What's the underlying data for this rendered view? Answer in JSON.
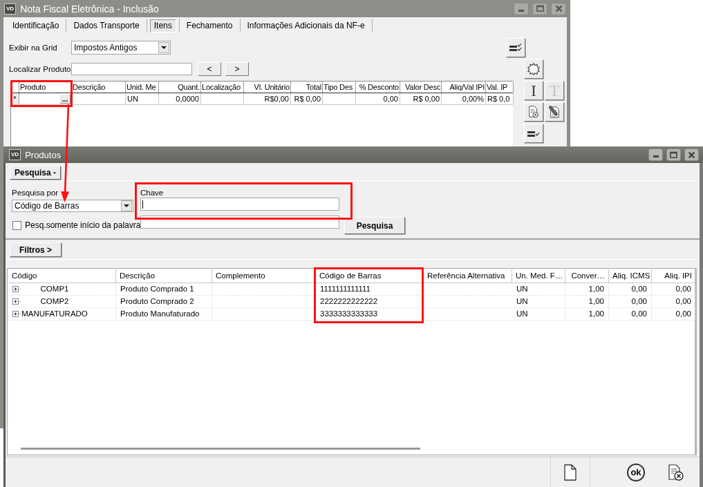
{
  "main_window": {
    "app_badge": "VD",
    "title": "Nota Fiscal Eletrônica - Inclusão",
    "tabs": [
      {
        "label": "Identificação",
        "selected": false
      },
      {
        "label": "Dados Transporte",
        "selected": false
      },
      {
        "label": "Itens",
        "selected": true
      },
      {
        "label": "Fechamento",
        "selected": false
      },
      {
        "label": "Informações Adicionais da NF-e",
        "selected": false
      }
    ],
    "grid_view": {
      "label": "Exibir na Grid",
      "value": "Impostos Antigos"
    },
    "view_options_button": {
      "kind": "list-check",
      "disabled": false
    },
    "find_product": {
      "label": "Localizar Produto",
      "buttons": [
        "<",
        ">"
      ]
    },
    "items_grid": {
      "columns": [
        {
          "label": "Produto",
          "highlighted": true
        },
        {
          "label": "Descrição",
          "highlighted": false
        },
        {
          "label": "Unid. Me",
          "highlighted": false
        },
        {
          "label": "Quant.",
          "highlighted": false
        },
        {
          "label": "Localização",
          "highlighted": false
        },
        {
          "label": "Vl. Unitário",
          "highlighted": false
        },
        {
          "label": "Total",
          "highlighted": false
        },
        {
          "label": "Tipo Des",
          "highlighted": false
        },
        {
          "label": "% Desconto",
          "highlighted": false
        },
        {
          "label": "Valor Desc",
          "highlighted": false
        },
        {
          "label": "Aliq/Val IPI",
          "highlighted": false
        },
        {
          "label": "Val. IP",
          "highlighted": false
        }
      ],
      "rows": [
        {
          "marker": "*",
          "product_button": "...",
          "column_3": "UN",
          "quantity": "0,0000",
          "unit_price": "R$0,00",
          "total": "R$ 0,00",
          "discount_percent": "0,00",
          "discount_value": "R$ 0,00",
          "ipi_rate": "0,00%",
          "column_12": "R$ 0,0"
        }
      ]
    },
    "side_toolbar": [
      {
        "kind": "seal",
        "disabled": false
      },
      {
        "kind": "letter",
        "label": "I",
        "disabled": false
      },
      {
        "kind": "letter",
        "label": "T",
        "disabled": true
      },
      {
        "kind": "document-cancel",
        "disabled": false
      },
      {
        "kind": "document-edit",
        "disabled": false
      },
      {
        "kind": "list-check",
        "disabled": false
      }
    ]
  },
  "search_window": {
    "app_badge": "VD",
    "title": "Produtos",
    "search_toggle": "Pesquisa -",
    "search_by": {
      "label": "Pesquisa por",
      "value": "Código de Barras"
    },
    "key": {
      "label": "Chave",
      "highlighted": true,
      "focused": true
    },
    "starts_with": {
      "label": "Pesq.somente início da palavra",
      "checked": false
    },
    "search_button": "Pesquisa",
    "filters_toggle": "Filtros >",
    "results": {
      "columns": [
        {
          "label": "Código",
          "highlighted": false
        },
        {
          "label": "Descrição",
          "highlighted": false
        },
        {
          "label": "Complemento",
          "highlighted": false
        },
        {
          "label": "Código de Barras",
          "highlighted": true
        },
        {
          "label": "Referência Alternativa",
          "highlighted": false
        },
        {
          "label": "Un. Med. F…",
          "highlighted": false
        },
        {
          "label": "Conver…",
          "highlighted": false
        },
        {
          "label": "Aliq. ICMS",
          "highlighted": false
        },
        {
          "label": "Aliq. IPI",
          "highlighted": false
        }
      ],
      "rows": [
        {
          "expanded": false,
          "code": "COMP1",
          "description": "Produto Comprado 1",
          "barcode": "1111111111111",
          "column_6": "UN",
          "column_7": "1,00",
          "icms_rate": "0,00",
          "ipi_rate": "0,00"
        },
        {
          "expanded": false,
          "code": "COMP2",
          "description": "Produto Comprado 2",
          "barcode": "2222222222222",
          "column_6": "UN",
          "column_7": "1,00",
          "icms_rate": "0,00",
          "ipi_rate": "0,00"
        },
        {
          "expanded": false,
          "code": "MANUFATURADO",
          "description": "Produto Manufaturado",
          "barcode": "3333333333333",
          "column_6": "UN",
          "column_7": "1,00",
          "icms_rate": "0,00",
          "ipi_rate": "0,00"
        }
      ]
    },
    "footer_buttons": [
      {
        "kind": "new-document"
      },
      {
        "kind": "ok",
        "label": "ok"
      },
      {
        "kind": "document-cancel"
      }
    ]
  },
  "annotation_arrow": true
}
